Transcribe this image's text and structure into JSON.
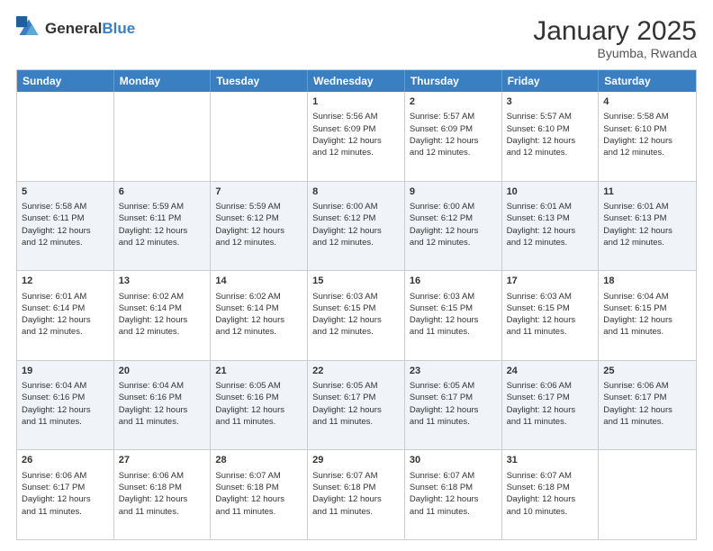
{
  "header": {
    "logo_general": "General",
    "logo_blue": "Blue",
    "month_title": "January 2025",
    "location": "Byumba, Rwanda"
  },
  "days_of_week": [
    "Sunday",
    "Monday",
    "Tuesday",
    "Wednesday",
    "Thursday",
    "Friday",
    "Saturday"
  ],
  "rows": [
    {
      "alt": false,
      "cells": [
        {
          "day": "",
          "lines": []
        },
        {
          "day": "",
          "lines": []
        },
        {
          "day": "",
          "lines": []
        },
        {
          "day": "1",
          "lines": [
            "Sunrise: 5:56 AM",
            "Sunset: 6:09 PM",
            "Daylight: 12 hours",
            "and 12 minutes."
          ]
        },
        {
          "day": "2",
          "lines": [
            "Sunrise: 5:57 AM",
            "Sunset: 6:09 PM",
            "Daylight: 12 hours",
            "and 12 minutes."
          ]
        },
        {
          "day": "3",
          "lines": [
            "Sunrise: 5:57 AM",
            "Sunset: 6:10 PM",
            "Daylight: 12 hours",
            "and 12 minutes."
          ]
        },
        {
          "day": "4",
          "lines": [
            "Sunrise: 5:58 AM",
            "Sunset: 6:10 PM",
            "Daylight: 12 hours",
            "and 12 minutes."
          ]
        }
      ]
    },
    {
      "alt": true,
      "cells": [
        {
          "day": "5",
          "lines": [
            "Sunrise: 5:58 AM",
            "Sunset: 6:11 PM",
            "Daylight: 12 hours",
            "and 12 minutes."
          ]
        },
        {
          "day": "6",
          "lines": [
            "Sunrise: 5:59 AM",
            "Sunset: 6:11 PM",
            "Daylight: 12 hours",
            "and 12 minutes."
          ]
        },
        {
          "day": "7",
          "lines": [
            "Sunrise: 5:59 AM",
            "Sunset: 6:12 PM",
            "Daylight: 12 hours",
            "and 12 minutes."
          ]
        },
        {
          "day": "8",
          "lines": [
            "Sunrise: 6:00 AM",
            "Sunset: 6:12 PM",
            "Daylight: 12 hours",
            "and 12 minutes."
          ]
        },
        {
          "day": "9",
          "lines": [
            "Sunrise: 6:00 AM",
            "Sunset: 6:12 PM",
            "Daylight: 12 hours",
            "and 12 minutes."
          ]
        },
        {
          "day": "10",
          "lines": [
            "Sunrise: 6:01 AM",
            "Sunset: 6:13 PM",
            "Daylight: 12 hours",
            "and 12 minutes."
          ]
        },
        {
          "day": "11",
          "lines": [
            "Sunrise: 6:01 AM",
            "Sunset: 6:13 PM",
            "Daylight: 12 hours",
            "and 12 minutes."
          ]
        }
      ]
    },
    {
      "alt": false,
      "cells": [
        {
          "day": "12",
          "lines": [
            "Sunrise: 6:01 AM",
            "Sunset: 6:14 PM",
            "Daylight: 12 hours",
            "and 12 minutes."
          ]
        },
        {
          "day": "13",
          "lines": [
            "Sunrise: 6:02 AM",
            "Sunset: 6:14 PM",
            "Daylight: 12 hours",
            "and 12 minutes."
          ]
        },
        {
          "day": "14",
          "lines": [
            "Sunrise: 6:02 AM",
            "Sunset: 6:14 PM",
            "Daylight: 12 hours",
            "and 12 minutes."
          ]
        },
        {
          "day": "15",
          "lines": [
            "Sunrise: 6:03 AM",
            "Sunset: 6:15 PM",
            "Daylight: 12 hours",
            "and 12 minutes."
          ]
        },
        {
          "day": "16",
          "lines": [
            "Sunrise: 6:03 AM",
            "Sunset: 6:15 PM",
            "Daylight: 12 hours",
            "and 11 minutes."
          ]
        },
        {
          "day": "17",
          "lines": [
            "Sunrise: 6:03 AM",
            "Sunset: 6:15 PM",
            "Daylight: 12 hours",
            "and 11 minutes."
          ]
        },
        {
          "day": "18",
          "lines": [
            "Sunrise: 6:04 AM",
            "Sunset: 6:15 PM",
            "Daylight: 12 hours",
            "and 11 minutes."
          ]
        }
      ]
    },
    {
      "alt": true,
      "cells": [
        {
          "day": "19",
          "lines": [
            "Sunrise: 6:04 AM",
            "Sunset: 6:16 PM",
            "Daylight: 12 hours",
            "and 11 minutes."
          ]
        },
        {
          "day": "20",
          "lines": [
            "Sunrise: 6:04 AM",
            "Sunset: 6:16 PM",
            "Daylight: 12 hours",
            "and 11 minutes."
          ]
        },
        {
          "day": "21",
          "lines": [
            "Sunrise: 6:05 AM",
            "Sunset: 6:16 PM",
            "Daylight: 12 hours",
            "and 11 minutes."
          ]
        },
        {
          "day": "22",
          "lines": [
            "Sunrise: 6:05 AM",
            "Sunset: 6:17 PM",
            "Daylight: 12 hours",
            "and 11 minutes."
          ]
        },
        {
          "day": "23",
          "lines": [
            "Sunrise: 6:05 AM",
            "Sunset: 6:17 PM",
            "Daylight: 12 hours",
            "and 11 minutes."
          ]
        },
        {
          "day": "24",
          "lines": [
            "Sunrise: 6:06 AM",
            "Sunset: 6:17 PM",
            "Daylight: 12 hours",
            "and 11 minutes."
          ]
        },
        {
          "day": "25",
          "lines": [
            "Sunrise: 6:06 AM",
            "Sunset: 6:17 PM",
            "Daylight: 12 hours",
            "and 11 minutes."
          ]
        }
      ]
    },
    {
      "alt": false,
      "cells": [
        {
          "day": "26",
          "lines": [
            "Sunrise: 6:06 AM",
            "Sunset: 6:17 PM",
            "Daylight: 12 hours",
            "and 11 minutes."
          ]
        },
        {
          "day": "27",
          "lines": [
            "Sunrise: 6:06 AM",
            "Sunset: 6:18 PM",
            "Daylight: 12 hours",
            "and 11 minutes."
          ]
        },
        {
          "day": "28",
          "lines": [
            "Sunrise: 6:07 AM",
            "Sunset: 6:18 PM",
            "Daylight: 12 hours",
            "and 11 minutes."
          ]
        },
        {
          "day": "29",
          "lines": [
            "Sunrise: 6:07 AM",
            "Sunset: 6:18 PM",
            "Daylight: 12 hours",
            "and 11 minutes."
          ]
        },
        {
          "day": "30",
          "lines": [
            "Sunrise: 6:07 AM",
            "Sunset: 6:18 PM",
            "Daylight: 12 hours",
            "and 11 minutes."
          ]
        },
        {
          "day": "31",
          "lines": [
            "Sunrise: 6:07 AM",
            "Sunset: 6:18 PM",
            "Daylight: 12 hours",
            "and 10 minutes."
          ]
        },
        {
          "day": "",
          "lines": []
        }
      ]
    }
  ]
}
